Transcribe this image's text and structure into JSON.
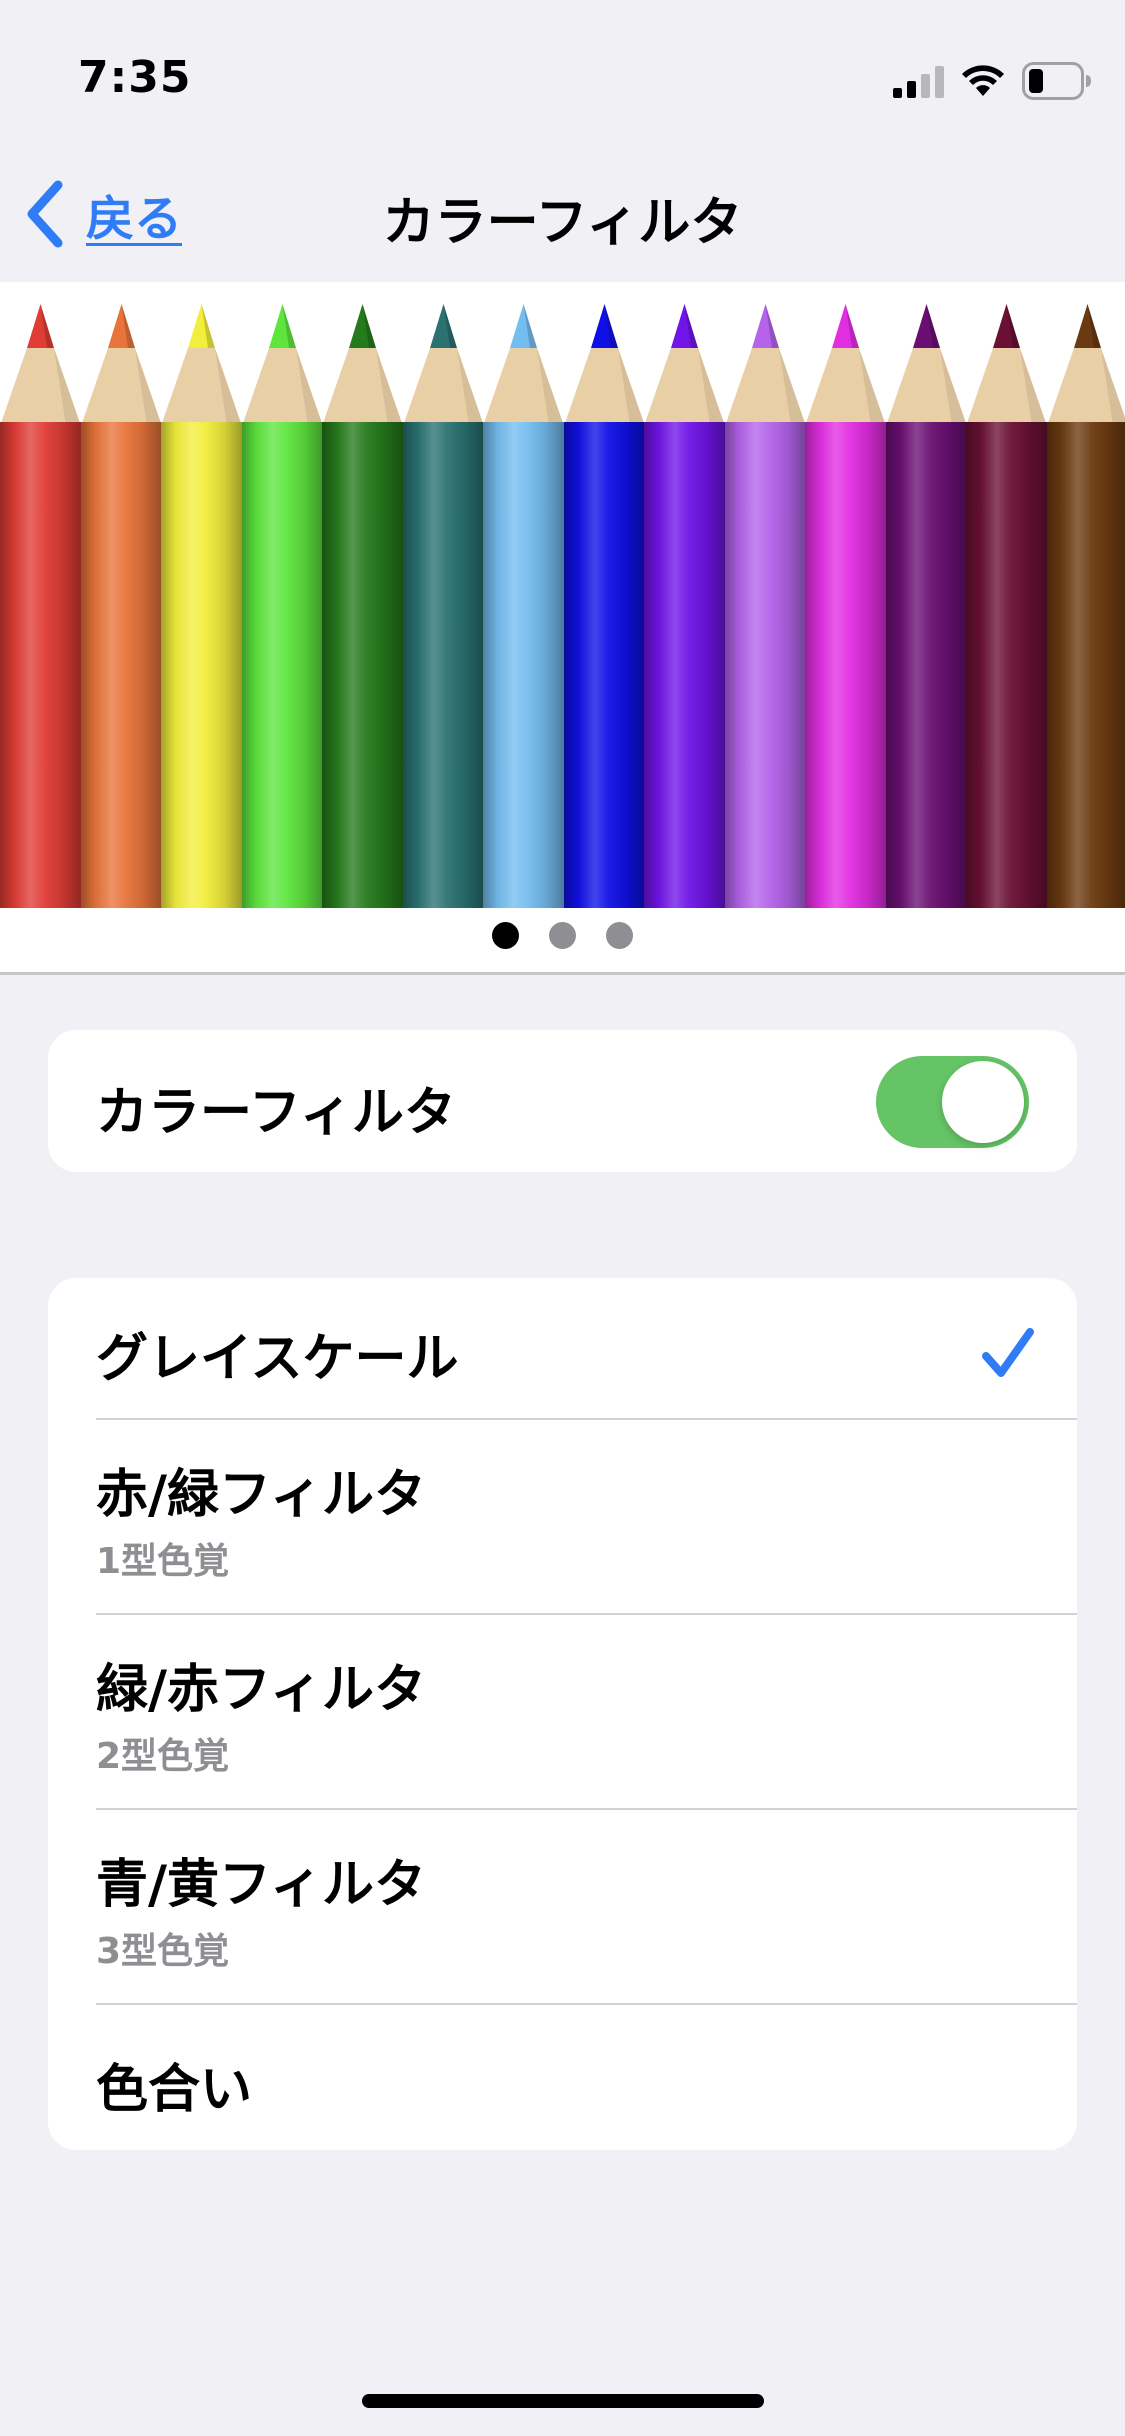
{
  "status_bar": {
    "time": "7:35",
    "icons": [
      "cellular-signal-icon",
      "wifi-icon",
      "battery-icon"
    ]
  },
  "nav": {
    "back_label": "戻る",
    "title": "カラーフィルタ",
    "accent_color": "#2f7cf6"
  },
  "preview": {
    "pencil_colors": [
      "#e03c36",
      "#e8743b",
      "#f2ee3d",
      "#5ee63e",
      "#257a1c",
      "#2a7272",
      "#74bdf0",
      "#1010e6",
      "#7014e8",
      "#b463ea",
      "#e22ee2",
      "#6a0f72",
      "#6a1035",
      "#6b3a10"
    ],
    "page_count": 3,
    "active_page": 0
  },
  "toggle": {
    "label": "カラーフィルタ",
    "on": true,
    "on_color": "#65c466"
  },
  "filters": {
    "items": [
      {
        "title": "グレイスケール",
        "subtitle": "",
        "selected": true
      },
      {
        "title": "赤/緑フィルタ",
        "subtitle": "1型色覚",
        "selected": false
      },
      {
        "title": "緑/赤フィルタ",
        "subtitle": "2型色覚",
        "selected": false
      },
      {
        "title": "青/黄フィルタ",
        "subtitle": "3型色覚",
        "selected": false
      },
      {
        "title": "色合い",
        "subtitle": "",
        "selected": false
      }
    ]
  }
}
